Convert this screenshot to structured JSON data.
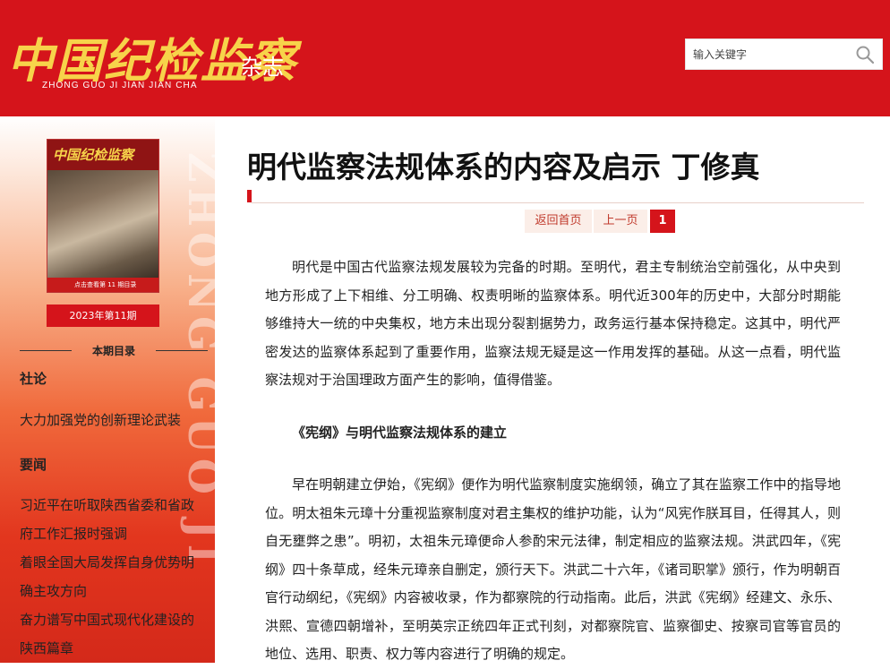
{
  "header": {
    "logo_cn": "中国纪检监察",
    "logo_pinyin": "ZHONG GUO JI JIAN JIAN CHA",
    "logo_suffix": "杂志",
    "search_placeholder": "输入关键字",
    "bg_color": "#d5141b",
    "logo_color": "#f7d34a"
  },
  "sidebar": {
    "watermark": "ZHONG GUO JI",
    "cover_title": "中国纪检监察",
    "cover_caption": "点击查看第 11 期目录",
    "issue": "2023年第11期",
    "toc_heading": "本期目录",
    "sections": [
      {
        "name": "社论",
        "items": [
          "大力加强党的创新理论武装"
        ]
      },
      {
        "name": "要闻",
        "items": [
          "习近平在听取陕西省委和省政府工作汇报时强调",
          "着眼全国大局发挥自身优势明确主攻方向",
          "奋力谱写中国式现代化建设的陕西篇章"
        ]
      }
    ]
  },
  "article": {
    "title": "明代监察法规体系的内容及启示 丁修真",
    "pager": {
      "home": "返回首页",
      "prev": "上一页",
      "current": "1"
    },
    "paragraphs": [
      "明代是中国古代监察法规发展较为完备的时期。至明代，君主专制统治空前强化，从中央到地方形成了上下相维、分工明确、权责明晰的监察体系。明代近300年的历史中，大部分时期能够维持大一统的中央集权，地方未出现分裂割据势力，政务运行基本保持稳定。这其中，明代严密发达的监察体系起到了重要作用，监察法规无疑是这一作用发挥的基础。从这一点看，明代监察法规对于治国理政方面产生的影响，值得借鉴。",
      "早在明朝建立伊始，《宪纲》便作为明代监察制度实施纲领，确立了其在监察工作中的指导地位。明太祖朱元璋十分重视监察制度对君主集权的维护功能，认为“风宪作朕耳目，任得其人，则自无壅弊之患”。明初，太祖朱元璋便命人参酌宋元法律，制定相应的监察法规。洪武四年，《宪纲》四十条草成，经朱元璋亲自删定，颁行天下。洪武二十六年，《诸司职掌》颁行，作为明朝百官行动纲纪，《宪纲》内容被收录，作为都察院的行动指南。此后，洪武《宪纲》经建文、永乐、洪熙、宣德四朝增补，至明英宗正统四年正式刊刻，对都察院官、监察御史、按察司官等官员的地位、选用、职责、权力等内容进行了明确的规定。"
    ],
    "subheading": "《宪纲》与明代监察法规体系的建立"
  }
}
